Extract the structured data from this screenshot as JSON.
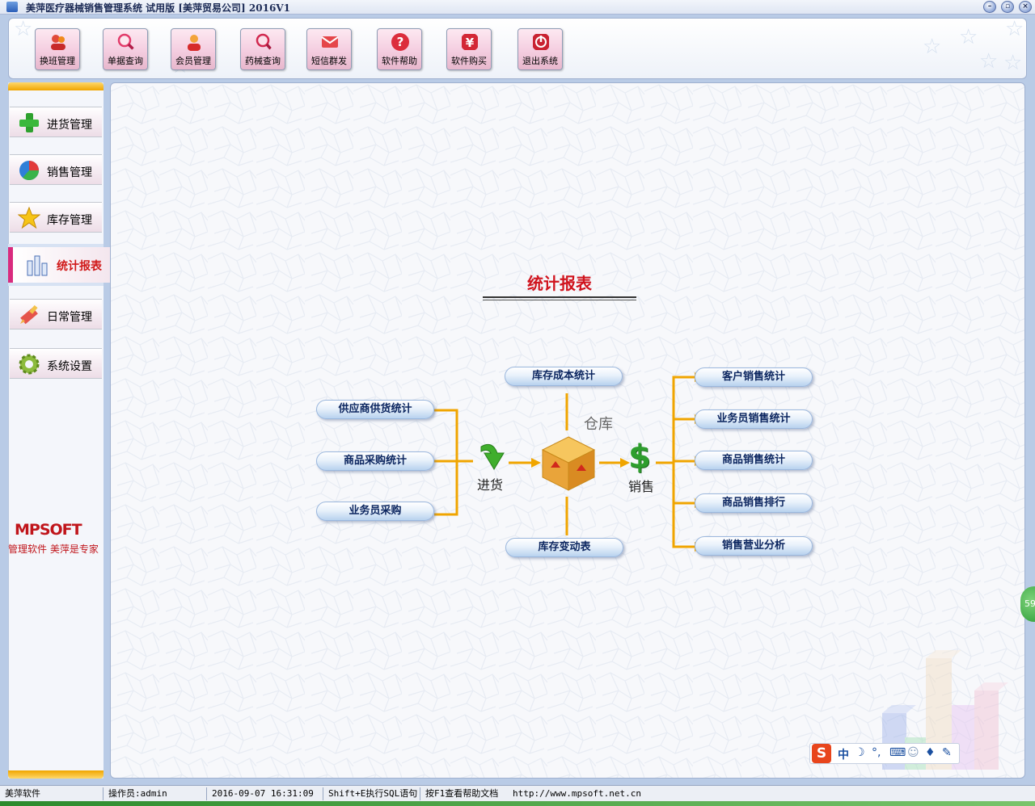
{
  "window": {
    "title": "美萍医疗器械销售管理系统 试用版 [美萍贸易公司] 2016V1"
  },
  "toolbar": {
    "items": [
      {
        "label": "换班管理",
        "icon": "user-group-icon"
      },
      {
        "label": "单据查询",
        "icon": "magnifier-icon"
      },
      {
        "label": "会员管理",
        "icon": "member-icon"
      },
      {
        "label": "药械查询",
        "icon": "search-document-icon"
      },
      {
        "label": "短信群发",
        "icon": "mail-icon"
      },
      {
        "label": "软件帮助",
        "icon": "help-icon"
      },
      {
        "label": "软件购买",
        "icon": "yen-icon"
      },
      {
        "label": "退出系统",
        "icon": "power-icon"
      }
    ]
  },
  "sidebar": {
    "items": [
      {
        "label": "进货管理",
        "icon": "green-plus-icon"
      },
      {
        "label": "销售管理",
        "icon": "pie-chart-icon"
      },
      {
        "label": "库存管理",
        "icon": "star-icon"
      },
      {
        "label": "统计报表",
        "icon": "bar-chart-icon",
        "active": true
      },
      {
        "label": "日常管理",
        "icon": "pencil-icon"
      },
      {
        "label": "系统设置",
        "icon": "gear-icon"
      }
    ],
    "logo_text": "MPSOFT",
    "slogan": "管理软件 美萍是专家"
  },
  "main": {
    "page_title": "统计报表",
    "left_buttons": [
      "供应商供货统计",
      "商品采购统计",
      "业务员采购"
    ],
    "top_button": "库存成本统计",
    "bottom_button": "库存变动表",
    "right_buttons": [
      "客户销售统计",
      "业务员销售统计",
      "商品销售统计",
      "商品销售排行",
      "销售营业分析"
    ],
    "node_labels": {
      "purchase": "进货",
      "warehouse": "仓库",
      "sales": "销售"
    },
    "dollar_sign": "$"
  },
  "ime": {
    "brand": "S",
    "mode": "中",
    "float_badge": "59"
  },
  "statusbar": {
    "company": "美萍软件",
    "operator": "操作员:admin",
    "datetime": "2016-09-07 16:31:09",
    "sql_hint": "Shift+E执行SQL语句",
    "help_hint": "按F1查看帮助文档",
    "url": "http://www.mpsoft.net.cn"
  },
  "colors": {
    "accent_orange": "#f0a500",
    "title_red": "#d0131d",
    "active_pink": "#d92b7e",
    "pill_text": "#0c2660"
  }
}
